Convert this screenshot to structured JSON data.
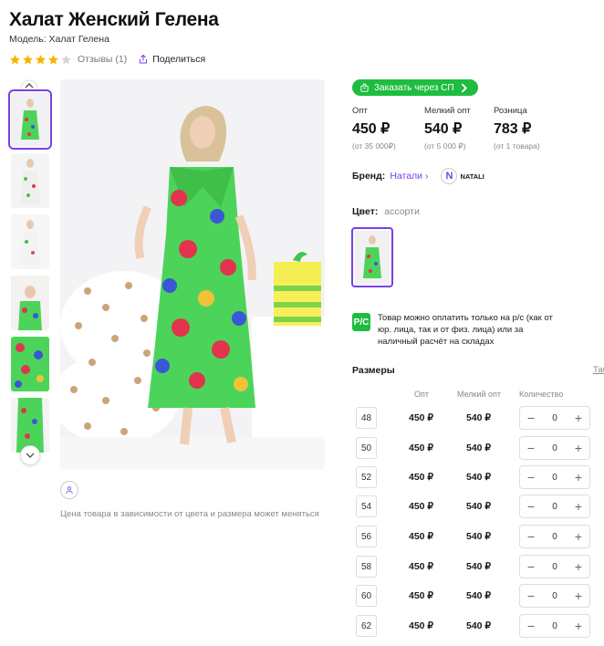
{
  "product": {
    "title": "Халат Женский Гелена",
    "model": "Модель: Халат Гелена",
    "rating": 4,
    "rating_max": 5,
    "reviews": "Отзывы (1)",
    "share": "Поделиться"
  },
  "order_sp": {
    "label": "Заказать через СП"
  },
  "prices": [
    {
      "label": "Опт",
      "value": "450 ₽",
      "sub": "(от 35 000₽)"
    },
    {
      "label": "Мелкий опт",
      "value": "540 ₽",
      "sub": "(от 5 000 ₽)"
    },
    {
      "label": "Розница",
      "value": "783 ₽",
      "sub": "(от 1 товара)"
    }
  ],
  "brand": {
    "label": "Бренд:",
    "name": "Натали",
    "logo_text": "NATALI",
    "logo_letter": "N"
  },
  "color": {
    "label": "Цвет:",
    "value": "ассорти"
  },
  "payment_note": {
    "icon": "Р/С",
    "text": "Товар можно оплатить только на р/с (как от юр. лица, так и от физ. лица) или за наличный расчёт на складах"
  },
  "sizes": {
    "title": "Размеры",
    "link": "Таб",
    "columns": {
      "opt": "Опт",
      "small": "Мелкий опт",
      "qty": "Количество"
    },
    "rows": [
      {
        "size": "48",
        "opt": "450 ₽",
        "small": "540 ₽",
        "qty": "0"
      },
      {
        "size": "50",
        "opt": "450 ₽",
        "small": "540 ₽",
        "qty": "0"
      },
      {
        "size": "52",
        "opt": "450 ₽",
        "small": "540 ₽",
        "qty": "0"
      },
      {
        "size": "54",
        "opt": "450 ₽",
        "small": "540 ₽",
        "qty": "0"
      },
      {
        "size": "56",
        "opt": "450 ₽",
        "small": "540 ₽",
        "qty": "0"
      },
      {
        "size": "58",
        "opt": "450 ₽",
        "small": "540 ₽",
        "qty": "0"
      },
      {
        "size": "60",
        "opt": "450 ₽",
        "small": "540 ₽",
        "qty": "0"
      },
      {
        "size": "62",
        "opt": "450 ₽",
        "small": "540 ₽",
        "qty": "0"
      }
    ],
    "minus": "−",
    "plus": "+"
  },
  "price_note": "Цена товара в зависимости от цвета и размера может меняться",
  "colors": {
    "accent": "#7b3fe4",
    "green": "#1fbd3f",
    "dress": "#4cd45a"
  }
}
